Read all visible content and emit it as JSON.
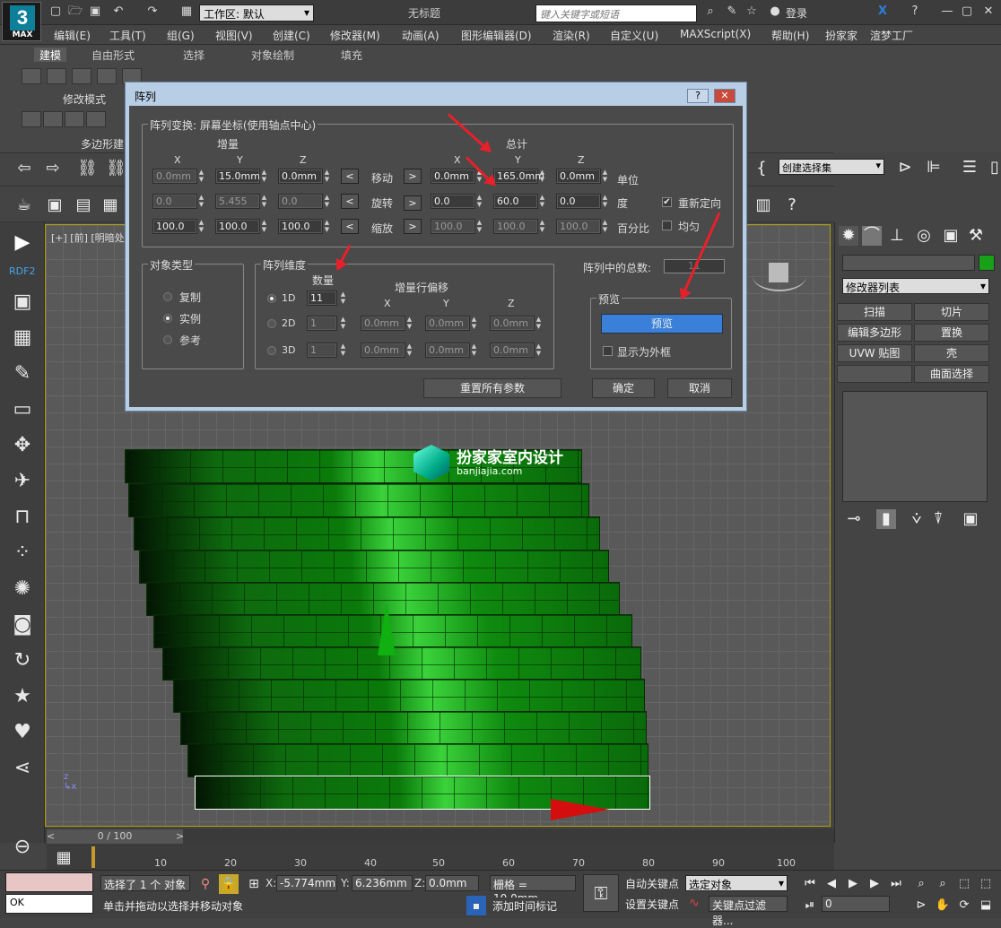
{
  "app": {
    "logo_text": "MAX",
    "title": "无标题",
    "workspace_label": "工作区: 默认",
    "search_placeholder": "键入关键字或短语",
    "login": "登录"
  },
  "menu": [
    "编辑(E)",
    "工具(T)",
    "组(G)",
    "视图(V)",
    "创建(C)",
    "修改器(M)",
    "动画(A)",
    "图形编辑器(D)",
    "渲染(R)",
    "自定义(U)",
    "MAXScript(X)",
    "帮助(H)",
    "扮家家",
    "渲梦工厂"
  ],
  "ribbon": {
    "tabs": [
      "建模",
      "自由形式",
      "选择",
      "对象绘制",
      "填充"
    ],
    "mode_label": "修改模式",
    "poly_label": "多边形建"
  },
  "toolbar": {
    "named_selection": "创建选择集"
  },
  "sidebar": {
    "rdf_label": "RDF2"
  },
  "viewport": {
    "label": "[+] [前] [明暗处",
    "watermark_title": "扮家家室内设计",
    "watermark_url": "banjiajia.com"
  },
  "dialog": {
    "title": "阵列",
    "help_btn": "?",
    "close_btn": "✕",
    "transform_group": "阵列变换: 屏幕坐标(使用轴点中心)",
    "increment_label": "增量",
    "total_label": "总计",
    "axis": [
      "X",
      "Y",
      "Z"
    ],
    "rows": [
      {
        "name": "移动",
        "inc": [
          "0.0mm",
          "15.0mm",
          "0.0mm"
        ],
        "tot": [
          "0.0mm",
          "165.0mm",
          "0.0mm"
        ],
        "unit": "单位"
      },
      {
        "name": "旋转",
        "inc": [
          "0.0",
          "5.455",
          "0.0"
        ],
        "tot": [
          "0.0",
          "60.0",
          "0.0"
        ],
        "unit": "度"
      },
      {
        "name": "缩放",
        "inc": [
          "100.0",
          "100.0",
          "100.0"
        ],
        "tot": [
          "100.0",
          "100.0",
          "100.0"
        ],
        "unit": "百分比"
      }
    ],
    "left_btn": "<",
    "right_btn": ">",
    "reorient": "重新定向",
    "uniform": "均匀",
    "object_type_group": "对象类型",
    "object_types": [
      "复制",
      "实例",
      "参考"
    ],
    "dimension_group": "阵列维度",
    "count_label": "数量",
    "row_offset_label": "增量行偏移",
    "dims": [
      {
        "name": "1D",
        "count": "11",
        "off": []
      },
      {
        "name": "2D",
        "count": "1",
        "off": [
          "0.0mm",
          "0.0mm",
          "0.0mm"
        ]
      },
      {
        "name": "3D",
        "count": "1",
        "off": [
          "0.0mm",
          "0.0mm",
          "0.0mm"
        ]
      }
    ],
    "total_in_array_label": "阵列中的总数:",
    "total_in_array": "11",
    "preview_group": "预览",
    "preview_btn": "预览",
    "show_as_box": "显示为外框",
    "reset_btn": "重置所有参数",
    "ok_btn": "确定",
    "cancel_btn": "取消"
  },
  "command_panel": {
    "modifier_list": "修改器列表",
    "buttons": [
      "扫描",
      "切片",
      "编辑多边形",
      "置换",
      "UVW 贴图",
      "壳",
      "",
      "曲面选择"
    ]
  },
  "timeline": {
    "position": "0 / 100",
    "ticks": [
      "10",
      "20",
      "30",
      "40",
      "50",
      "60",
      "70",
      "80",
      "90",
      "100"
    ]
  },
  "status": {
    "maxscript": "OK",
    "selected": "选择了 1 个 对象",
    "prompt": "单击并拖动以选择并移动对象",
    "x_label": "X:",
    "x": "-5.774mm",
    "y_label": "Y:",
    "y": "6.236mm",
    "z_label": "Z:",
    "z": "0.0mm",
    "grid": "栅格 = 10.0mm",
    "add_time_tag": "添加时间标记",
    "auto_key": "自动关键点",
    "set_key": "设置关键点",
    "sel_obj": "选定对象",
    "key_filters": "关键点过滤器...",
    "frame": "0"
  },
  "colors": {
    "accent": "#3a7fd8",
    "dialog_frame": "#b8cee4",
    "annotation": "#e8202a",
    "object": "#0a7a0a"
  }
}
